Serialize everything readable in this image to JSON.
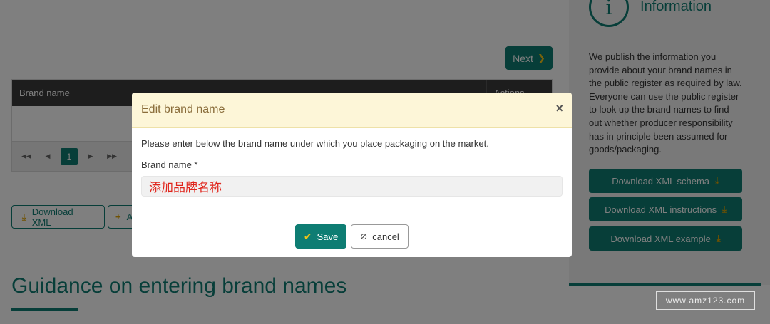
{
  "pager": {
    "next_label": "Next",
    "current_page": "1",
    "first_icon": "first-page-icon",
    "prev_icon": "prev-page-icon",
    "next_icon": "next-page-icon",
    "last_icon": "last-page-icon"
  },
  "table": {
    "columns": [
      "Brand name",
      "Actions"
    ]
  },
  "actions": {
    "download_xml_label": "Download XML",
    "add_partial_label": "A"
  },
  "guidance": {
    "title": "Guidance on entering brand names"
  },
  "sidebar": {
    "title": "Information",
    "text": "We publish the information you provide about your brand names in the public register as required by law. Everyone can use the public register to look up the brand names to find out whether producer responsibility has in principle been assumed for goods/packaging.",
    "buttons": [
      {
        "label": "Download XML schema"
      },
      {
        "label": "Download XML instructions"
      },
      {
        "label": "Download XML example"
      }
    ]
  },
  "modal": {
    "title": "Edit brand name",
    "close_symbol": "×",
    "description": "Please enter below the brand name under which you place packaging on the market.",
    "field_label": "Brand name *",
    "field_value": "添加品牌名称",
    "save_label": "Save",
    "cancel_label": "cancel"
  },
  "watermark": {
    "text": "www.amz123.com"
  },
  "colors": {
    "primary": "#0e7d73",
    "accent": "#f0c419",
    "modal_header_bg": "#fdf6d8",
    "input_text": "#e0241b"
  }
}
